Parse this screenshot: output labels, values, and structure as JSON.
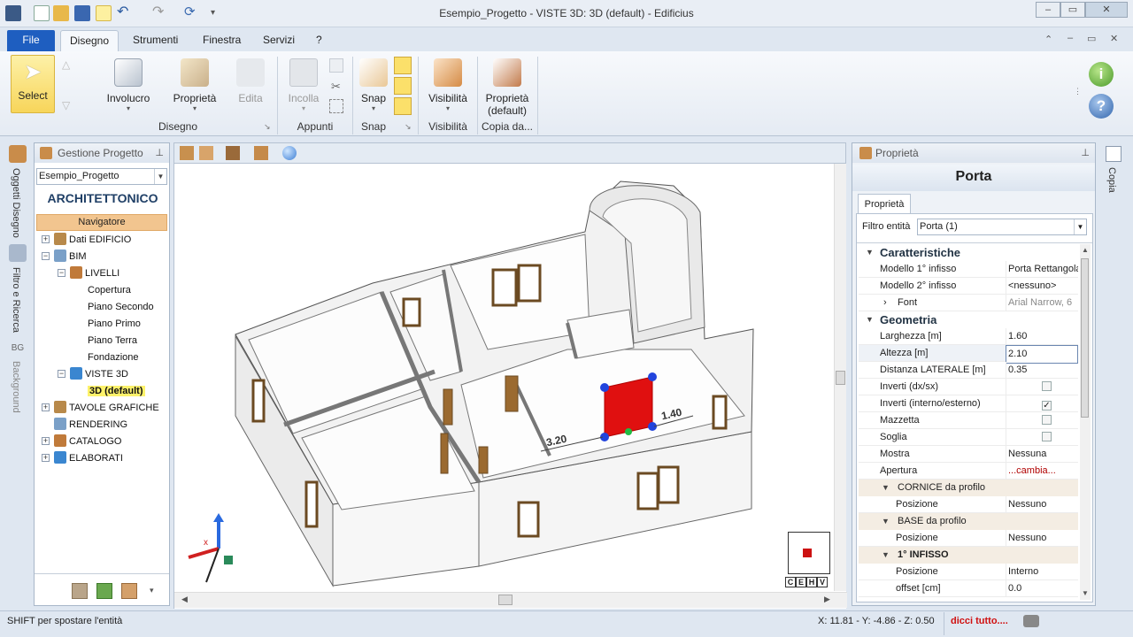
{
  "window": {
    "title": "Esempio_Progetto -  VISTE 3D: 3D (default) - Edificius"
  },
  "menu": {
    "file": "File",
    "tabs": [
      "Disegno",
      "Strumenti",
      "Finestra",
      "Servizi",
      "?"
    ]
  },
  "ribbon": {
    "select": "Select",
    "involucro": "Involucro",
    "proprieta": "Proprietà",
    "edita": "Edita",
    "incolla": "Incolla",
    "snap": "Snap",
    "visibilita": "Visibilità",
    "proprieta_default_1": "Proprietà",
    "proprieta_default_2": "(default)",
    "groups": {
      "disegno": "Disegno",
      "appunti": "Appunti",
      "snap": "Snap",
      "visibilita": "Visibilità",
      "copia": "Copia da..."
    }
  },
  "left_tabs": [
    "Oggetti Disegno",
    "Filtro e Ricerca",
    "Background"
  ],
  "project_panel": {
    "title": "Gestione Progetto",
    "project": "Esempio_Progetto",
    "heading": "ARCHITETTONICO",
    "navigator": "Navigatore",
    "tree": [
      {
        "label": "Dati EDIFICIO",
        "level": 0,
        "exp": "+"
      },
      {
        "label": "BIM",
        "level": 0,
        "exp": "−"
      },
      {
        "label": "LIVELLI",
        "level": 1,
        "exp": "−"
      },
      {
        "label": "Copertura",
        "level": 2,
        "exp": ""
      },
      {
        "label": "Piano Secondo",
        "level": 2,
        "exp": ""
      },
      {
        "label": "Piano Primo",
        "level": 2,
        "exp": ""
      },
      {
        "label": "Piano Terra",
        "level": 2,
        "exp": ""
      },
      {
        "label": "Fondazione",
        "level": 2,
        "exp": ""
      },
      {
        "label": "VISTE 3D",
        "level": 1,
        "exp": "−"
      },
      {
        "label": "3D (default)",
        "level": 2,
        "exp": "",
        "selected": true
      },
      {
        "label": "TAVOLE GRAFICHE",
        "level": 0,
        "exp": "+"
      },
      {
        "label": "RENDERING",
        "level": 0,
        "exp": ""
      },
      {
        "label": "CATALOGO",
        "level": 0,
        "exp": "+"
      },
      {
        "label": "ELABORATI",
        "level": 0,
        "exp": "+"
      }
    ]
  },
  "viewport": {
    "dimension_left": "3.20",
    "dimension_right": "1.40",
    "view_cube": [
      "C",
      "E",
      "H",
      "V"
    ],
    "axis_label": "x"
  },
  "right_tab": "Copia",
  "properties": {
    "title": "Proprietà",
    "entity": "Porta",
    "tab": "Proprietà",
    "filter_label": "Filtro entità",
    "filter_value": "Porta (1)",
    "rows": [
      {
        "type": "cat",
        "label": "Caratteristiche"
      },
      {
        "type": "row",
        "k": "Modello 1° infisso",
        "v": "Porta Rettangola"
      },
      {
        "type": "row",
        "k": "Modello 2° infisso",
        "v": "<nessuno>"
      },
      {
        "type": "row",
        "k": "Font",
        "v": "Arial Narrow, 6",
        "exp": "›",
        "grey": true
      },
      {
        "type": "cat",
        "label": "Geometria"
      },
      {
        "type": "row",
        "k": "Larghezza  [m]",
        "v": "1.60"
      },
      {
        "type": "row",
        "k": "Altezza  [m]",
        "v": "2.10",
        "edit": true
      },
      {
        "type": "row",
        "k": "Distanza LATERALE  [m]",
        "v": "0.35"
      },
      {
        "type": "row",
        "k": "Inverti (dx/sx)",
        "check": false
      },
      {
        "type": "row",
        "k": "Inverti (interno/esterno)",
        "check": true
      },
      {
        "type": "row",
        "k": "Mazzetta",
        "check": false
      },
      {
        "type": "row",
        "k": "Soglia",
        "check": false
      },
      {
        "type": "row",
        "k": "Mostra",
        "v": "Nessuna"
      },
      {
        "type": "row",
        "k": "Apertura",
        "v": "...cambia...",
        "link": true
      },
      {
        "type": "sub",
        "label": "CORNICE da profilo"
      },
      {
        "type": "row",
        "k": "Posizione",
        "v": "Nessuno",
        "indent": true
      },
      {
        "type": "sub",
        "label": "BASE da profilo"
      },
      {
        "type": "row",
        "k": "Posizione",
        "v": "Nessuno",
        "indent": true
      },
      {
        "type": "sub",
        "label": "1° INFISSO",
        "bold": true
      },
      {
        "type": "row",
        "k": "Posizione",
        "v": "Interno",
        "indent": true
      },
      {
        "type": "row",
        "k": "offset  [cm]",
        "v": "0.0",
        "indent": true
      }
    ]
  },
  "status": {
    "hint": "SHIFT per spostare l'entità",
    "coords": "X: 11.81 - Y: -4.86 - Z: 0.50",
    "promo": "dicci tutto...."
  }
}
